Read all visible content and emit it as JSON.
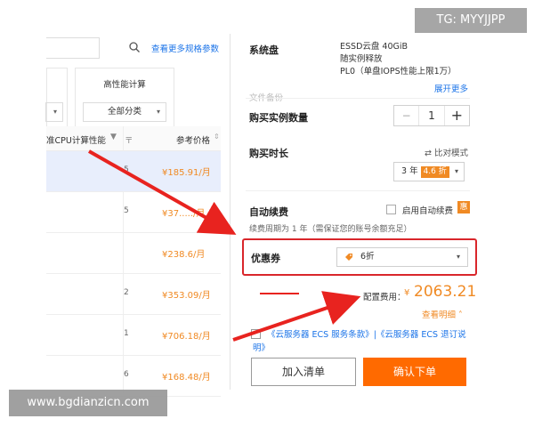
{
  "watermark_tg": "TG: MYYJJPP",
  "watermark_site": "www.bgdianzicn.com",
  "colors": {
    "accent_orange": "#ff6a00",
    "price_orange": "#f08a24",
    "highlight_red": "#d9262b",
    "link_blue": "#1a73e8"
  },
  "left": {
    "more_link": "查看更多规格参数",
    "filter_b_title": "高性能计算",
    "filter_b_value": "全部分类",
    "table": {
      "col_cpu": "准CPU计算性能",
      "col_price": "参考价格",
      "rows": [
        {
          "mid": "5",
          "price": "¥185.91/月",
          "selected": true
        },
        {
          "mid": "5",
          "price": "¥37...../月",
          "selected": false
        },
        {
          "mid": "",
          "price": "¥238.6/月",
          "selected": false
        },
        {
          "mid": "2",
          "price": "¥353.09/月",
          "selected": false
        },
        {
          "mid": "1",
          "price": "¥706.18/月",
          "selected": false
        },
        {
          "mid": "6",
          "price": "¥168.48/月",
          "selected": false
        }
      ]
    }
  },
  "right": {
    "system_disk_label": "系统盘",
    "system_disk_lines": [
      "ESSD云盘 40GiB",
      "随实例释放",
      "PL0（单盘IOPS性能上限1万）"
    ],
    "expand_more": "展开更多",
    "faded_label": "文件备份",
    "quantity_label": "购买实例数量",
    "quantity_value": "1",
    "duration_label": "购买时长",
    "compare_mode": "比对模式",
    "duration_value": "3 年",
    "duration_discount": "4.6 折",
    "auto_renew_label": "自动续费",
    "auto_renew_option": "启用自动续费",
    "hui_badge": "惠",
    "renew_note": "续费周期为 1 年（需保证您的账号余额充足）",
    "coupon_label": "优惠券",
    "coupon_value": "6折",
    "cost_label": "配置费用：",
    "cost_currency": "¥",
    "cost_value": "2063.21",
    "detail_link": "查看明细",
    "agreement_text": "《云服务器 ECS 服务条款》|《云服务器 ECS 退订说明》",
    "add_to_list": "加入清单",
    "confirm_order": "确认下单"
  }
}
